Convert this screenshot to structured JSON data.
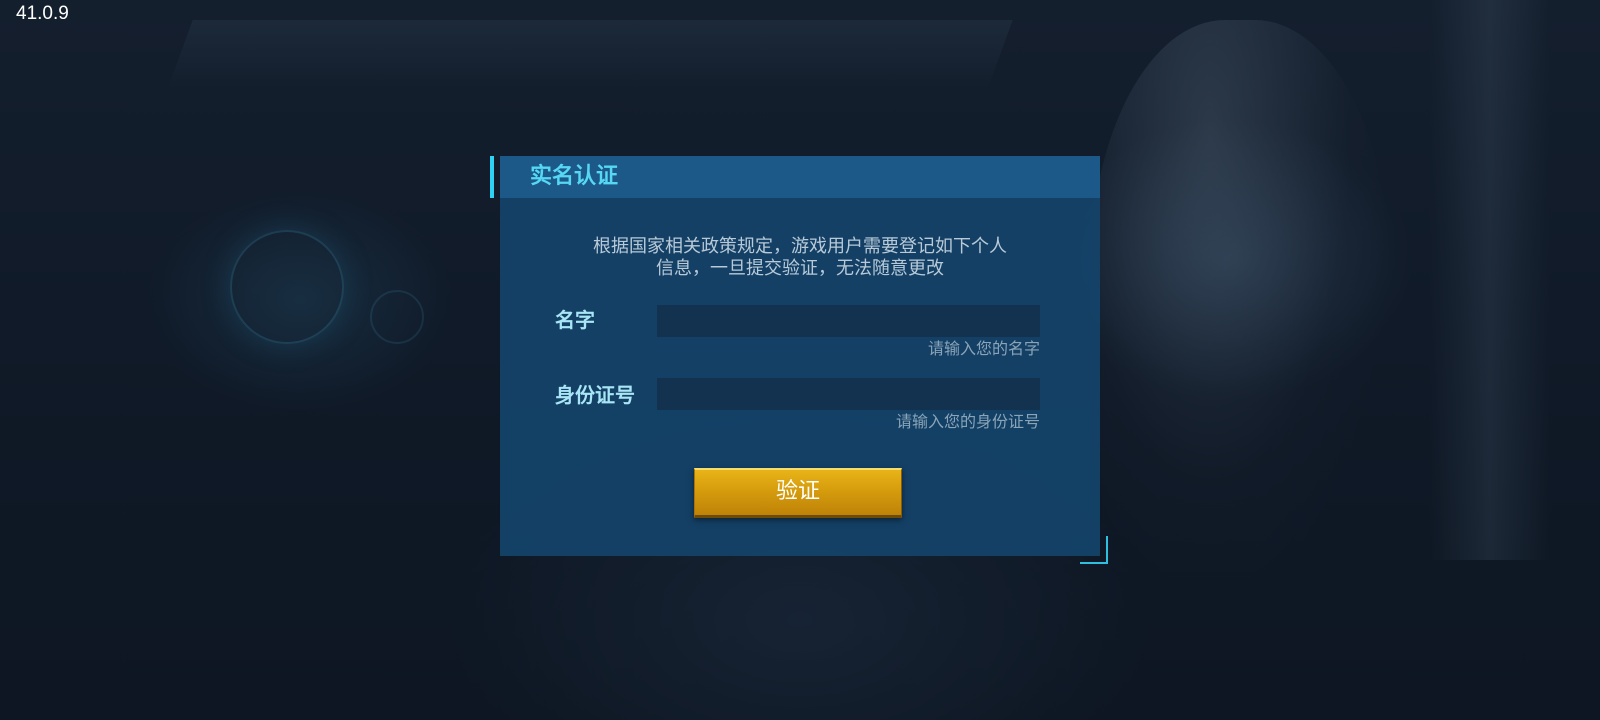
{
  "version": "41.0.9",
  "dialog": {
    "title": "实名认证",
    "notice_line1": "根据国家相关政策规定，游戏用户需要登记如下个人",
    "notice_line2": "信息，一旦提交验证，无法随意更改",
    "name_field": {
      "label": "名字",
      "value": "",
      "hint": "请输入您的名字"
    },
    "id_field": {
      "label": "身份证号",
      "value": "",
      "hint": "请输入您的身份证号"
    },
    "verify_button": "验证"
  },
  "colors": {
    "accent": "#2fd2f2",
    "title": "#56d8f5",
    "button": "#d69c0d",
    "panel": "#14466e"
  }
}
